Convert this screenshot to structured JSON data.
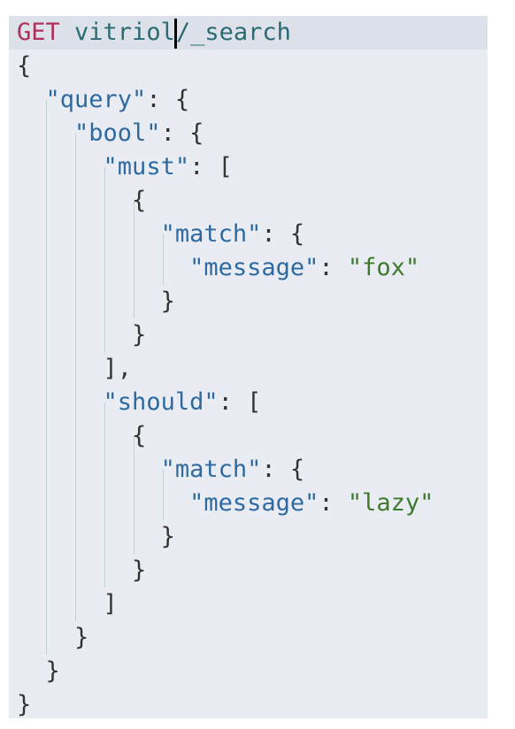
{
  "request": {
    "method": "GET",
    "path_before_cursor": " vitriol",
    "path_after_cursor": "/_search"
  },
  "body": {
    "open_brace": "{",
    "close_brace": "}",
    "query_key": "\"query\"",
    "bool_key": "\"bool\"",
    "must_key": "\"must\"",
    "should_key": "\"should\"",
    "match_key": "\"match\"",
    "message_key": "\"message\"",
    "must_value": "\"fox\"",
    "should_value": "\"lazy\"",
    "colon_brace": ": {",
    "colon_bracket": ": [",
    "colon": ": ",
    "close_bracket_comma": "],",
    "close_bracket": "]"
  },
  "colors": {
    "background": "#e9edf3",
    "method": "#b0305c",
    "path": "#2a6a73",
    "key": "#2e6aa0",
    "string": "#3d7a2c"
  }
}
